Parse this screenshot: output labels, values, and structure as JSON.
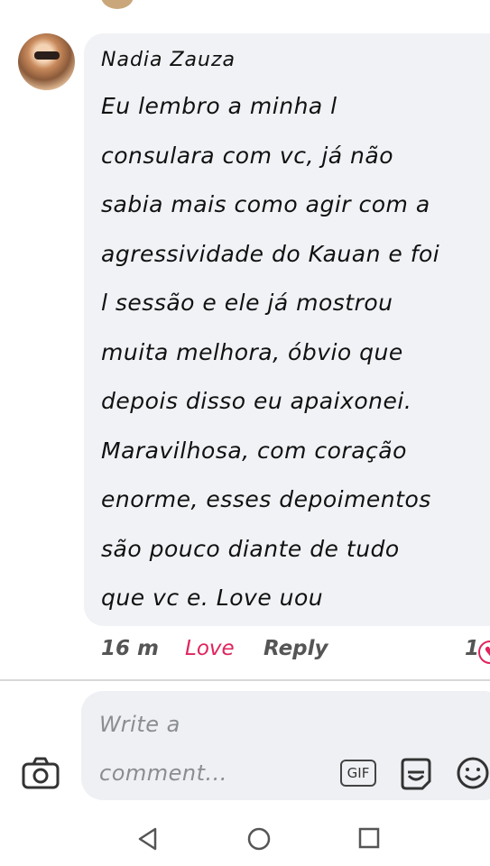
{
  "comment": {
    "author": "Nadia Zauza",
    "body_lines": [
      "Eu lembro a minha l",
      "consulara com vc, já não",
      "sabia mais como agir com a",
      "agressividade do Kauan e foi",
      "l sessão e ele já mostrou",
      "muita melhora, óbvio que",
      "depois disso eu apaixonei.",
      "Maravilhosa, com coração",
      "enorme, esses depoimentos",
      "são pouco diante de tudo",
      "que vc e. Love uou"
    ],
    "time": "16 m",
    "reaction_label": "Love",
    "reply_label": "Reply",
    "reaction_count": "1",
    "reaction_icon": "heart-reaction-icon"
  },
  "composer": {
    "placeholder_line1": "Write a",
    "placeholder_line2": "comment...",
    "gif_label": "GIF",
    "camera_icon": "camera-icon",
    "sticker_icon": "sticker-icon",
    "emoji_icon": "emoji-icon"
  },
  "colors": {
    "accent_love": "#e0245e",
    "bubble_bg": "#f0f2f5",
    "muted_text": "#8a8d91"
  },
  "navigation": {
    "back_icon": "back-triangle-icon",
    "home_icon": "home-circle-icon",
    "recents_icon": "recents-square-icon"
  }
}
